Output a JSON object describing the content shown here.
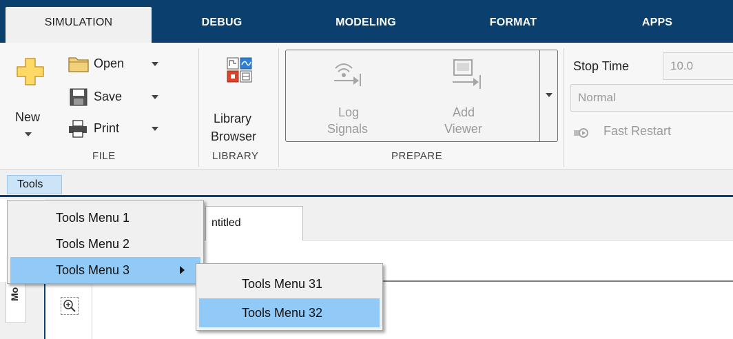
{
  "tabs": [
    {
      "label": "SIMULATION",
      "active": true
    },
    {
      "label": "DEBUG",
      "active": false
    },
    {
      "label": "MODELING",
      "active": false
    },
    {
      "label": "FORMAT",
      "active": false
    },
    {
      "label": "APPS",
      "active": false
    }
  ],
  "ribbon": {
    "file": {
      "new_label": "New",
      "open_label": "Open",
      "save_label": "Save",
      "print_label": "Print",
      "group_label": "FILE"
    },
    "library": {
      "line1": "Library",
      "line2": "Browser",
      "group_label": "LIBRARY"
    },
    "prepare": {
      "log_line1": "Log",
      "log_line2": "Signals",
      "add_line1": "Add",
      "add_line2": "Viewer",
      "group_label": "PREPARE"
    },
    "simulate": {
      "stop_time_label": "Stop Time",
      "stop_time_value": "10.0",
      "mode_value": "Normal",
      "fast_restart_label": "Fast Restart"
    }
  },
  "toolbar": {
    "tools_label": "Tools"
  },
  "editor": {
    "doc_tab_label": "ntitled",
    "vertical_tab_label": "Mo"
  },
  "menus": {
    "tools_menu": [
      {
        "label": "Tools Menu 1",
        "highlighted": false,
        "submenu": false
      },
      {
        "label": "Tools Menu 2",
        "highlighted": false,
        "submenu": false
      },
      {
        "label": "Tools Menu 3",
        "highlighted": true,
        "submenu": true
      }
    ],
    "submenu": [
      {
        "label": "Tools Menu 31",
        "highlighted": false
      },
      {
        "label": "Tools Menu 32",
        "highlighted": true
      }
    ]
  },
  "colors": {
    "tab_bar": "#0b3f6d",
    "menu_highlight": "#91c9f7",
    "tools_button": "#cce4f7"
  }
}
